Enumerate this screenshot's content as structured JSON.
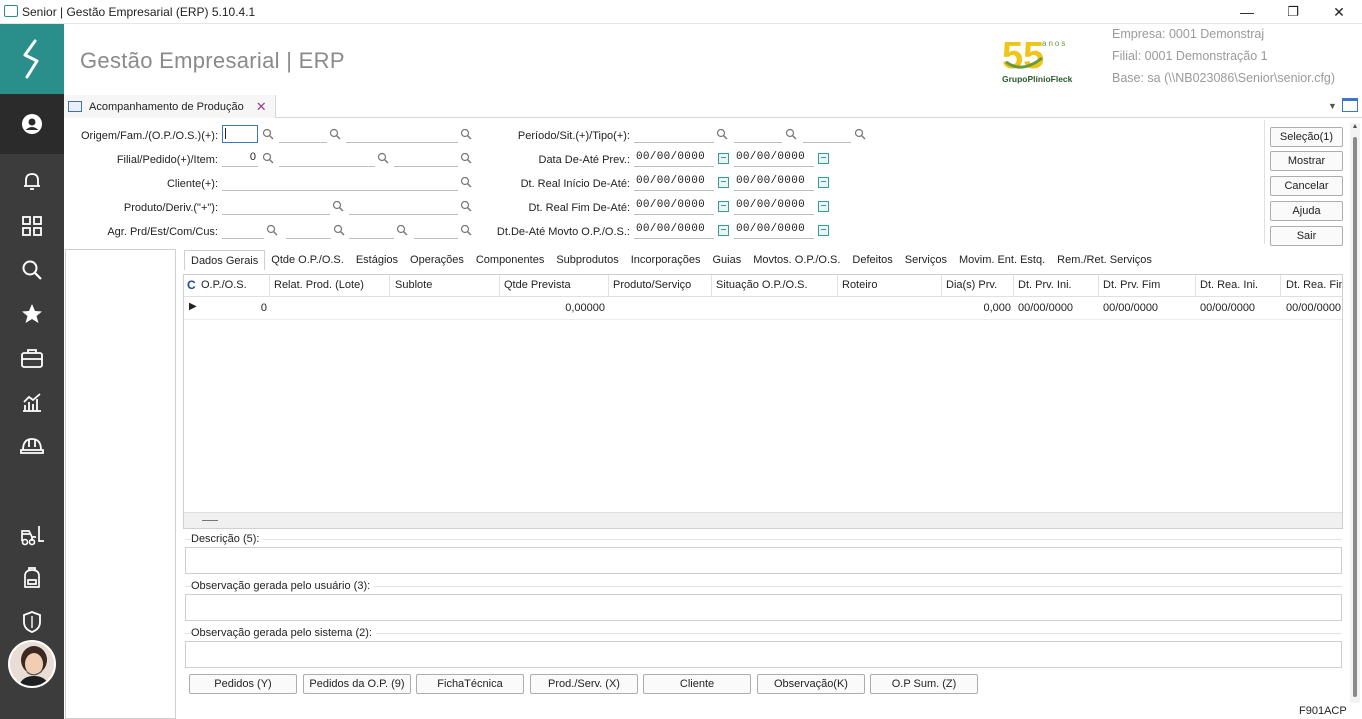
{
  "window": {
    "title": "Senior | Gestão Empresarial (ERP) 5.10.4.1",
    "minimize": "—",
    "maximize": "❐",
    "close": "✕"
  },
  "header": {
    "app_title": "Gestão Empresarial | ERP",
    "brand_text": "GrupoPlínioFleck",
    "brand_years": "55",
    "brand_anos": "anos",
    "empresa": "Empresa: 0001 Demonstraj",
    "filial": "Filial: 0001 Demonstração 1",
    "base": "Base: sa (\\\\NB023086\\Senior\\senior.cfg)"
  },
  "tab": {
    "label": "Acompanhamento de Produção"
  },
  "filters": {
    "origem_label": "Origem/Fam./(O.P./O.S.)(+):",
    "filial_label": "Filial/Pedido(+)/Item:",
    "filial_value": "0",
    "cliente_label": "Cliente(+):",
    "produto_label": "Produto/Deriv.(\"+\"):",
    "agr_label": "Agr. Prd/Est/Com/Cus:",
    "periodo_label": "Período/Sit.(+)/Tipo(+):",
    "data_prev_label": "Data De-Até Prev.:",
    "real_ini_label": "Dt. Real Início De-Até:",
    "real_fim_label": "Dt. Real Fim De-Até:",
    "movto_label": "Dt.De-Até Movto O.P./O.S.:",
    "date_empty": "00/00/0000"
  },
  "buttons": {
    "selecao": "Seleção(1)",
    "mostrar": "Mostrar",
    "cancelar": "Cancelar",
    "ajuda": "Ajuda",
    "sair": "Sair"
  },
  "tabs": [
    "Dados Gerais",
    "Qtde O.P./O.S.",
    "Estágios",
    "Operações",
    "Componentes",
    "Subprodutos",
    "Incorporações",
    "Guias",
    "Movtos. O.P./O.S.",
    "Defeitos",
    "Serviços",
    "Movim. Ent. Estq.",
    "Rem./Ret. Serviços"
  ],
  "grid": {
    "corner": "C",
    "columns": [
      "O.P./O.S.",
      "Relat. Prod. (Lote)",
      "Sublote",
      "Qtde Prevista",
      "Produto/Serviço",
      "Situação O.P./O.S.",
      "Roteiro",
      "Dia(s) Prv.",
      "Dt. Prv. Ini.",
      "Dt. Prv. Fim",
      "Dt. Rea. Ini.",
      "Dt. Rea. Fim"
    ],
    "row": {
      "op": "0",
      "qtde": "0,00000",
      "dias": "0,000",
      "prv_ini": "00/00/0000",
      "prv_fim": "00/00/0000",
      "rea_ini": "00/00/0000",
      "rea_fim": "00/00/0000"
    }
  },
  "sections": {
    "descricao": "Descrição (5):",
    "obs_usuario": "Observação gerada pelo usuário (3):",
    "obs_sistema": "Observação gerada pelo sistema (2):"
  },
  "bottom_buttons": [
    "Pedidos (Y)",
    "Pedidos da O.P. (9)",
    "FichaTécnica",
    "Prod./Serv. (X)",
    "Cliente",
    "Observação(K)",
    "O.P Sum. (Z)"
  ],
  "status": {
    "code": "F901ACP"
  },
  "sidebar": {
    "icons": [
      "user-icon",
      "bell-icon",
      "grid-icon",
      "search-icon",
      "star-icon",
      "briefcase-icon",
      "chart-icon",
      "helmet-icon",
      "forklift-icon",
      "backpack-icon",
      "shield-icon"
    ]
  },
  "colors": {
    "accent": "#2a8f8a",
    "sidebar": "#3c3c3c"
  }
}
